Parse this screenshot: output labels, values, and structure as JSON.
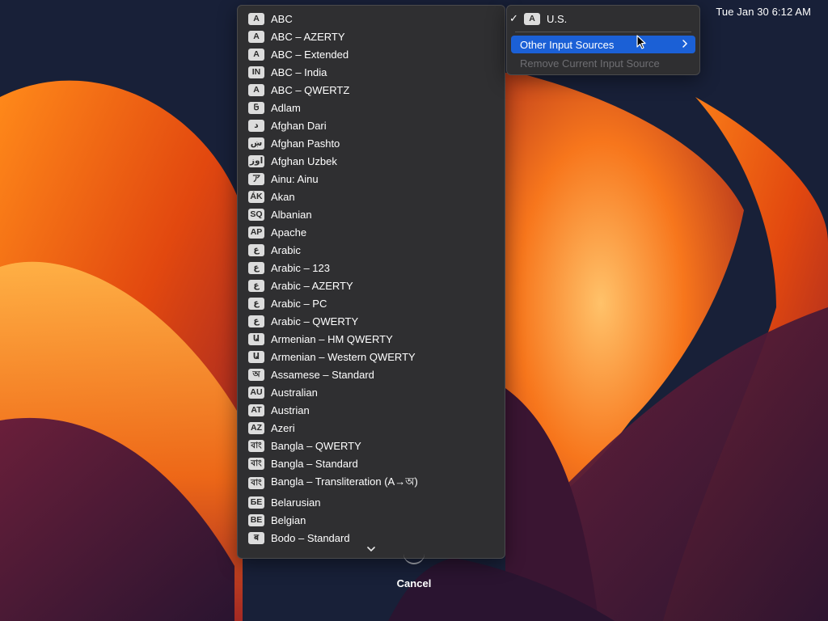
{
  "menubar": {
    "clock": "Tue Jan 30 6:12 AM"
  },
  "input_sources": [
    {
      "badge": "A",
      "label": "ABC"
    },
    {
      "badge": "A",
      "label": "ABC – AZERTY"
    },
    {
      "badge": "A",
      "label": "ABC – Extended"
    },
    {
      "badge": "IN",
      "label": "ABC – India"
    },
    {
      "badge": "A",
      "label": "ABC – QWERTZ"
    },
    {
      "badge": "𞤀",
      "label": "Adlam"
    },
    {
      "badge": "د",
      "label": "Afghan Dari"
    },
    {
      "badge": "ښ",
      "label": "Afghan Pashto"
    },
    {
      "badge": "اوز",
      "label": "Afghan Uzbek"
    },
    {
      "badge": "ア",
      "label": "Ainu: Ainu"
    },
    {
      "badge": "ÁK",
      "label": "Akan"
    },
    {
      "badge": "SQ",
      "label": "Albanian"
    },
    {
      "badge": "AP",
      "label": "Apache"
    },
    {
      "badge": "ع",
      "label": "Arabic"
    },
    {
      "badge": "ع",
      "label": "Arabic – 123"
    },
    {
      "badge": "ع",
      "label": "Arabic – AZERTY"
    },
    {
      "badge": "ع",
      "label": "Arabic – PC"
    },
    {
      "badge": "ع",
      "label": "Arabic – QWERTY"
    },
    {
      "badge": "Ա",
      "label": "Armenian – HM QWERTY"
    },
    {
      "badge": "Ա",
      "label": "Armenian – Western QWERTY"
    },
    {
      "badge": "অ",
      "label": "Assamese – Standard"
    },
    {
      "badge": "AU",
      "label": "Australian"
    },
    {
      "badge": "AT",
      "label": "Austrian"
    },
    {
      "badge": "AZ",
      "label": "Azeri"
    },
    {
      "badge": "বাং",
      "label": "Bangla – QWERTY"
    },
    {
      "badge": "বাং",
      "label": "Bangla – Standard"
    },
    {
      "badge": "বাং",
      "label": "Bangla – Transliteration (A→অ)"
    },
    {
      "badge": "БЕ",
      "label": "Belarusian"
    },
    {
      "badge": "BE",
      "label": "Belgian"
    },
    {
      "badge": "ब",
      "label": "Bodo – Standard"
    }
  ],
  "menu": {
    "current_badge": "A",
    "current_label": "U.S.",
    "other_label": "Other Input Sources",
    "remove_label": "Remove Current Input Source"
  },
  "cancel_label": "Cancel",
  "colors": {
    "highlight": "#1b60d6",
    "menu_bg": "#2f2f31"
  }
}
